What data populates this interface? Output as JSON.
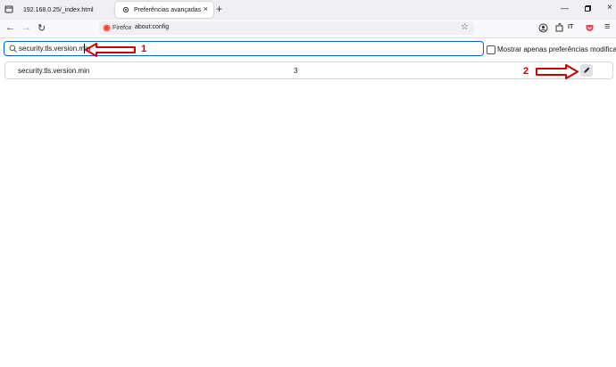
{
  "tabs": [
    {
      "title": "192.168.0.25/_index.html"
    },
    {
      "title": "Preferências avançadas"
    }
  ],
  "toolbar": {
    "identity_label": "Firefox",
    "url": "about:config"
  },
  "config": {
    "search_value": "security.tls.version.min",
    "checkbox_label": "Mostrar apenas preferências modificadas",
    "checkbox_checked": false,
    "rows": [
      {
        "name": "security.tls.version.min",
        "value": "3"
      }
    ]
  },
  "annotations": {
    "step1": "1",
    "step2": "2",
    "color": "#d00000"
  },
  "icons": [
    "tab-list-icon",
    "gear-icon",
    "close-icon",
    "new-tab-icon",
    "minimize-icon",
    "maximize-icon",
    "window-close-icon",
    "back-icon",
    "forward-icon",
    "reload-icon",
    "firefox-icon",
    "bookmark-star-icon",
    "account-icon",
    "extensions-icon",
    "pocket-icon",
    "menu-icon",
    "search-icon",
    "pencil-icon"
  ]
}
